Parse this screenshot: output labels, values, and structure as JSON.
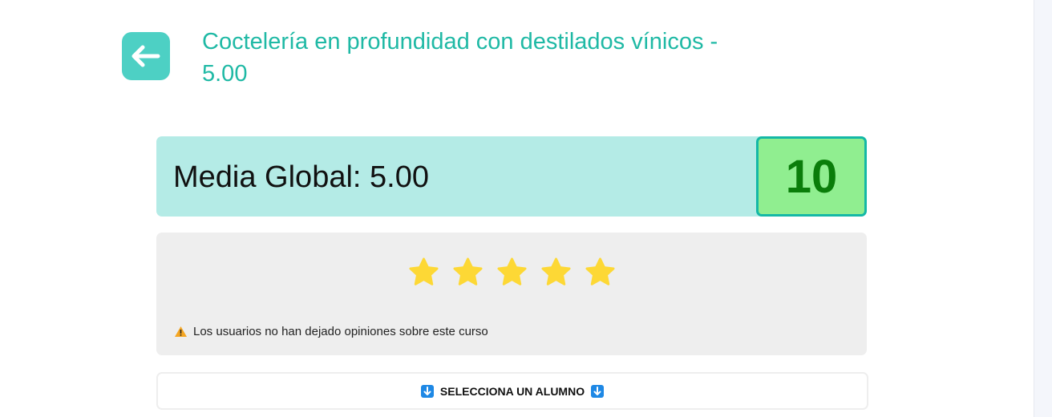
{
  "header": {
    "back_icon": "arrow-left-icon",
    "title": "Coctelería en profundidad con destilados vínicos - 5.00"
  },
  "summary": {
    "label": "Media Global: 5.00",
    "score": "10",
    "score_color": "#0a7d0a",
    "bar_color": "#b4ebe6",
    "score_bg": "#90ee90"
  },
  "rating": {
    "stars_filled": 5,
    "stars_total": 5,
    "star_color": "#fdd835",
    "notice_icon": "warning-icon",
    "notice_text": "Los usuarios no han dejado opiniones sobre este curso"
  },
  "select_student": {
    "label": "SELECCIONA UN ALUMNO",
    "icon": "down-arrow-icon"
  },
  "accent": "#1fb9a5"
}
